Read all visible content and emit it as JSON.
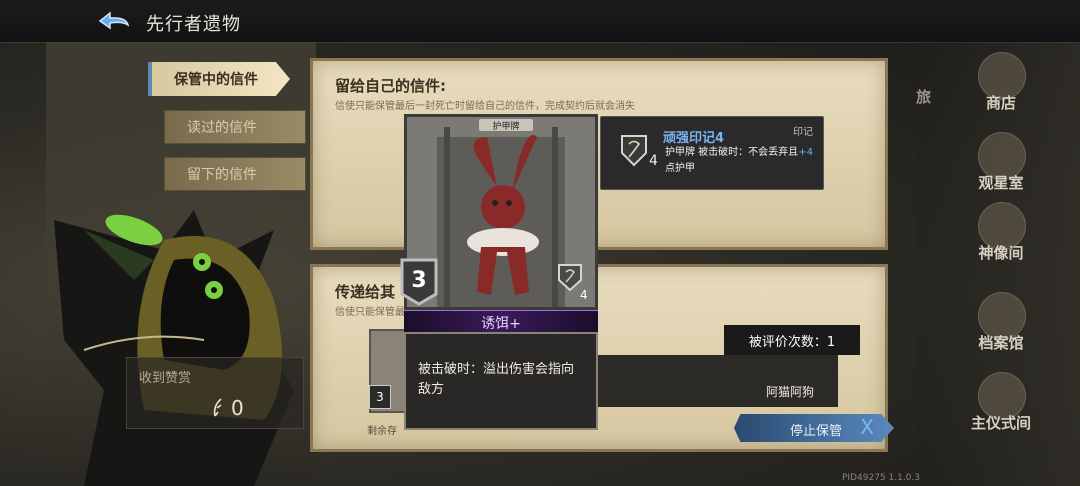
{
  "header": {
    "title": "先行者遗物"
  },
  "tabs": [
    {
      "label": "保管中的信件",
      "active": true
    },
    {
      "label": "读过的信件",
      "active": false
    },
    {
      "label": "留下的信件",
      "active": false
    }
  ],
  "reward": {
    "label": "收到赞赏",
    "value": "0"
  },
  "panel_top": {
    "title": "留给自己的信件:",
    "subtitle": "信使只能保管最后一封死亡时留给自己的信件，完成契约后就会消失"
  },
  "panel_bottom": {
    "title": "传递给其",
    "subtitle": "信使只能保管最",
    "remaining": "剩余存"
  },
  "small_card": {
    "cost": "3"
  },
  "card": {
    "type": "护甲牌",
    "cost": "3",
    "shield": "4",
    "name": "诱饵+",
    "description": "被击破时：溢出伤害会指向敌方"
  },
  "tooltip": {
    "title": "顽强印记4",
    "tag": "印记",
    "number": "4",
    "body_before": "护甲牌 被击破时：不会丢弃且",
    "body_highlight": "+4",
    "body_after": "点护甲"
  },
  "rating": {
    "label": "被评价次数：1"
  },
  "sender": {
    "name": "阿猫阿狗"
  },
  "stop_button": {
    "label": "停止保管",
    "x": "X"
  },
  "nav": {
    "travel": "旅",
    "items": [
      "商店",
      "观星室",
      "神像间",
      "档案馆",
      "主仪式间"
    ]
  },
  "version": "PID49275  1.1.0.3",
  "colors": {
    "accent": "#5a8abe",
    "tooltip_title": "#7ab4f0",
    "card_name": "#e8d4ff"
  }
}
